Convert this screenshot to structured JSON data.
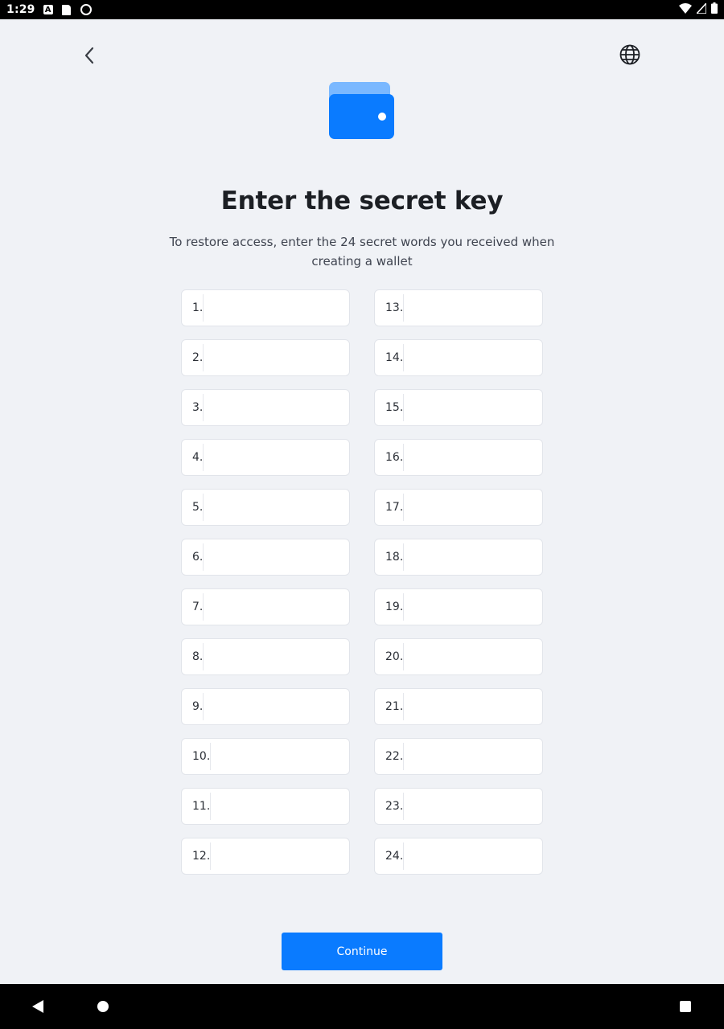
{
  "status_bar": {
    "time": "1:29",
    "left_icons": [
      "a-notification-icon",
      "sd-card-icon",
      "sync-circle-icon"
    ],
    "right_icons": [
      "wifi-icon",
      "signal-icon",
      "battery-icon"
    ]
  },
  "header": {
    "back_icon": "chevron-left-icon",
    "language_icon": "globe-icon"
  },
  "hero": {
    "icon": "wallet-icon",
    "wallet_color": "#0a7bff",
    "wallet_tab_color": "#7ab8ff"
  },
  "title": "Enter the secret key",
  "subtitle": "To restore access, enter the 24 secret words you received when creating a wallet",
  "words": [
    {
      "label": "1.",
      "value": ""
    },
    {
      "label": "2.",
      "value": ""
    },
    {
      "label": "3.",
      "value": ""
    },
    {
      "label": "4.",
      "value": ""
    },
    {
      "label": "5.",
      "value": ""
    },
    {
      "label": "6.",
      "value": ""
    },
    {
      "label": "7.",
      "value": ""
    },
    {
      "label": "8.",
      "value": ""
    },
    {
      "label": "9.",
      "value": ""
    },
    {
      "label": "10.",
      "value": ""
    },
    {
      "label": "11.",
      "value": ""
    },
    {
      "label": "12.",
      "value": ""
    },
    {
      "label": "13.",
      "value": ""
    },
    {
      "label": "14.",
      "value": ""
    },
    {
      "label": "15.",
      "value": ""
    },
    {
      "label": "16.",
      "value": ""
    },
    {
      "label": "17.",
      "value": ""
    },
    {
      "label": "18.",
      "value": ""
    },
    {
      "label": "19.",
      "value": ""
    },
    {
      "label": "20.",
      "value": ""
    },
    {
      "label": "21.",
      "value": ""
    },
    {
      "label": "22.",
      "value": ""
    },
    {
      "label": "23.",
      "value": ""
    },
    {
      "label": "24.",
      "value": ""
    }
  ],
  "continue_label": "Continue",
  "accent_color": "#0a7bff",
  "nav_bar": {
    "icons": [
      "back-triangle-icon",
      "home-circle-icon",
      "recents-square-icon"
    ]
  }
}
